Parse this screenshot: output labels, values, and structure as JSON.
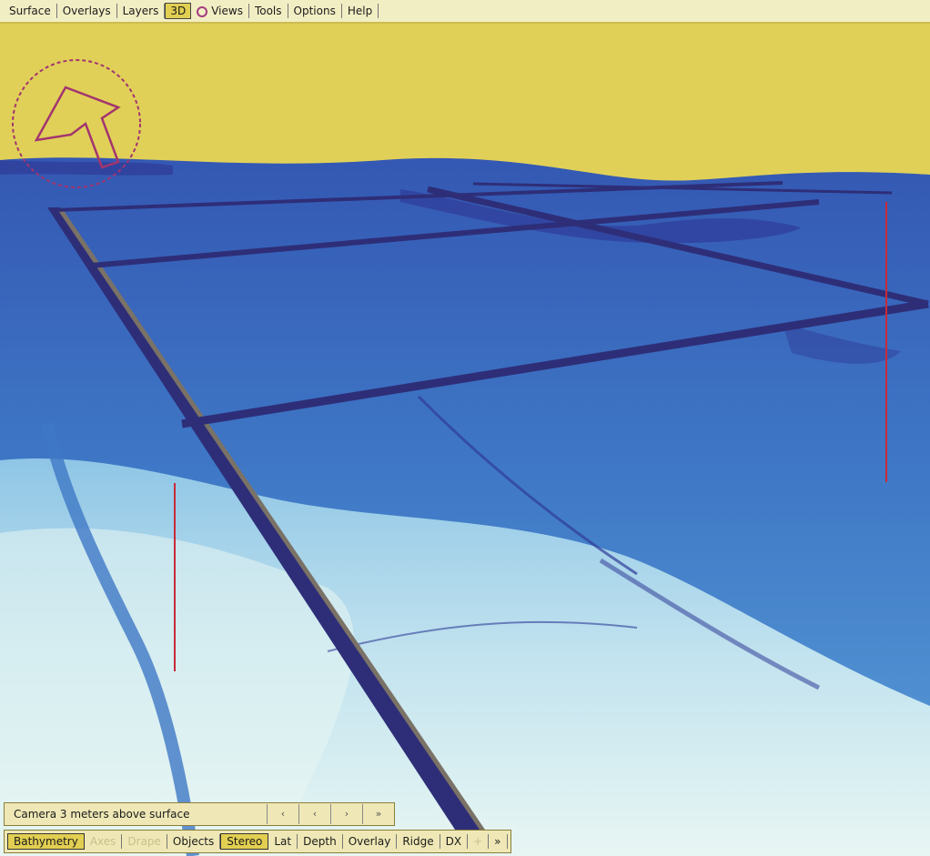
{
  "top_toolbar": {
    "items": [
      "Surface",
      "Overlays",
      "Layers",
      "3D",
      "Views",
      "Tools",
      "Options",
      "Help"
    ],
    "active_item": "3D"
  },
  "view_status": {
    "text": "Camera 3 meters above surface",
    "steps": [
      "‹",
      "‹",
      "›",
      "»"
    ]
  },
  "bottom_toolbar": {
    "items": [
      "Bathymetry",
      "Axes",
      "Drape",
      "Objects",
      "Stereo",
      "Lat",
      "Depth",
      "Overlay",
      "Ridge",
      "DX",
      "+",
      "»"
    ],
    "active_items": [
      "Bathymetry",
      "Stereo"
    ],
    "dim_items": [
      "Axes",
      "Drape",
      "+"
    ]
  },
  "compass": {
    "icon": "navigation-arrow-icon",
    "color": "#a3356f"
  },
  "scene": {
    "sky_color": "#e0d058",
    "depth_colors": [
      "#2a2e7a",
      "#2f3c98",
      "#3458b3",
      "#3f78c6",
      "#5a9fd8",
      "#8fc6e6",
      "#c2e3ef",
      "#e8f6f3"
    ],
    "grid_line_color": "#2e2e78",
    "marker_line_color": "#c82a3a"
  }
}
